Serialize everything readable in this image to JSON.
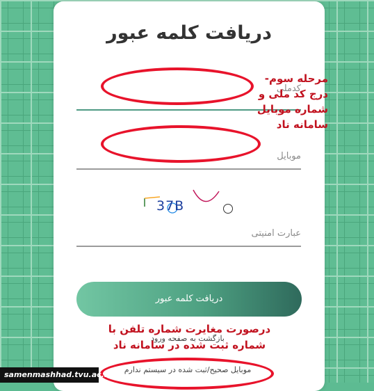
{
  "page": {
    "title": "دریافت کلمه عبور"
  },
  "form": {
    "national_code_placeholder": "کدملی",
    "mobile_placeholder": "موبایل",
    "captcha_text": "37B",
    "security_placeholder": "عبارت امنیتی",
    "submit_label": "دریافت کلمه عبور",
    "back_link": "بازگشت به صفحه ورود",
    "no_mobile_link": "موبایل صحیح/ثبت شده در سیستم ندارم"
  },
  "annotations": {
    "step3": "مرحله سوم- درج کد ملی و شماره موبایل سامانه ناد",
    "mismatch": "درصورت مغایرت شماره تلفن با شماره ثبت شده در سامانه ناد"
  },
  "footer": {
    "watermark": "samenmashhad.tvu.ac.ir"
  },
  "colors": {
    "accent": "#4ea182",
    "annotation": "#c1121f"
  }
}
